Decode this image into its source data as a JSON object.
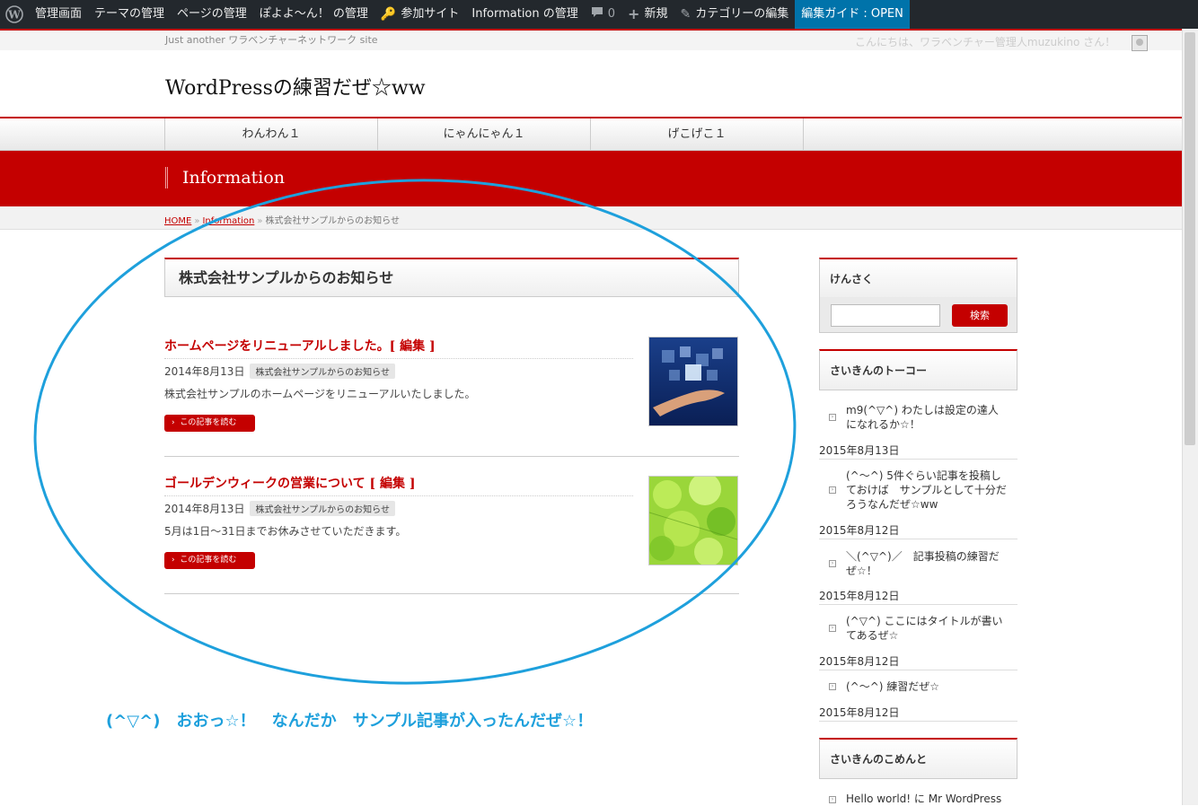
{
  "admin_bar": {
    "items": [
      "管理画面",
      "テーマの管理",
      "ページの管理",
      "ぽよよ〜ん！ の管理",
      "参加サイト",
      "Information の管理",
      "0",
      "新規",
      "カテゴリーの編集",
      "編集ガイド : OPEN"
    ]
  },
  "header": {
    "tagline": "Just another ワラベンチャーネットワーク site",
    "greeting": "こんにちは、ワラベンチャー管理人muzukino さん！",
    "site_title": "WordPressの練習だぜ☆ww"
  },
  "nav": {
    "items": [
      "わんわん１",
      "にゃんにゃん１",
      "げこげこ１"
    ]
  },
  "page": {
    "title": "Information"
  },
  "breadcrumb": {
    "home": "HOME",
    "section": "Information",
    "current": "株式会社サンプルからのお知らせ"
  },
  "category_heading": "株式会社サンプルからのお知らせ",
  "posts": [
    {
      "title": "ホームページをリニューアルしました。[ 編集 ]",
      "date": "2014年8月13日",
      "category": "株式会社サンプルからのお知らせ",
      "excerpt": "株式会社サンプルのホームページをリニューアルいたしました。",
      "read_more": "この記事を読む"
    },
    {
      "title": "ゴールデンウィークの営業について [ 編集 ]",
      "date": "2014年8月13日",
      "category": "株式会社サンプルからのお知らせ",
      "excerpt": "5月は1日〜31日までお休みさせていただきます。",
      "read_more": "この記事を読む"
    }
  ],
  "sidebar": {
    "search": {
      "heading": "けんさく",
      "button": "検索",
      "value": ""
    },
    "recent": {
      "heading": "さいきんのトーコー",
      "items": [
        {
          "title": "m9(^▽^) わたしは設定の達人になれるか☆！",
          "date": "2015年8月13日"
        },
        {
          "title": "(^〜^) 5件ぐらい記事を投稿しておけば　サンプルとして十分だろうなんだぜ☆ww",
          "date": "2015年8月12日"
        },
        {
          "title": "＼(^▽^)／　記事投稿の練習だぜ☆！",
          "date": "2015年8月12日"
        },
        {
          "title": "(^▽^) ここにはタイトルが書いてあるぜ☆",
          "date": "2015年8月12日"
        },
        {
          "title": "(^〜^) 練習だぜ☆",
          "date": "2015年8月12日"
        }
      ]
    },
    "comments": {
      "heading": "さいきんのこめんと",
      "items": [
        {
          "text": "Hello world! に Mr WordPress"
        }
      ]
    }
  },
  "annotation": {
    "text": "(^▽^)　おおっ☆！　なんだか　サンプル記事が入ったんだぜ☆！",
    "color": "#1ea0dc"
  },
  "colors": {
    "brand_red": "#c40000",
    "admin_bar": "#23282d",
    "admin_highlight": "#0073aa"
  },
  "icons": [
    "wordpress-logo-icon",
    "key-icon",
    "comment-icon",
    "plus-icon",
    "pencil-icon",
    "user-avatar-icon"
  ]
}
